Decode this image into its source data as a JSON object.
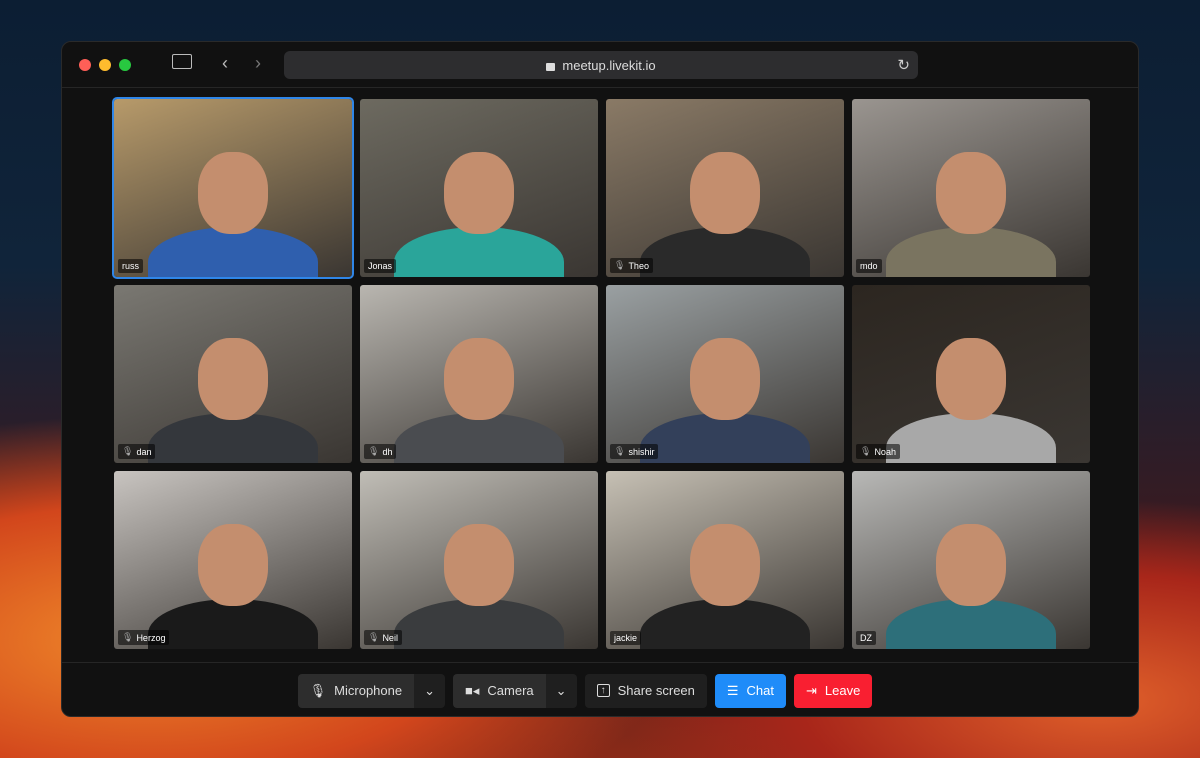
{
  "browser": {
    "url": "meetup.livekit.io",
    "traffic_lights": [
      "#fe5f57",
      "#febc2e",
      "#28c840"
    ]
  },
  "participants": [
    {
      "name": "russ",
      "muted": false,
      "active": true,
      "bg": "#b79a6a",
      "shirt": "#2f5fae"
    },
    {
      "name": "Jonas",
      "muted": false,
      "active": false,
      "bg": "#6d6a60",
      "shirt": "#2aa59a"
    },
    {
      "name": "Theo",
      "muted": true,
      "active": false,
      "bg": "#8a7a66",
      "shirt": "#2a2a2a"
    },
    {
      "name": "mdo",
      "muted": false,
      "active": false,
      "bg": "#9a9590",
      "shirt": "#7a7460"
    },
    {
      "name": "dan",
      "muted": true,
      "active": false,
      "bg": "#7a7872",
      "shirt": "#34373c"
    },
    {
      "name": "dh",
      "muted": true,
      "active": false,
      "bg": "#b9b6b0",
      "shirt": "#4a4c50"
    },
    {
      "name": "shishir",
      "muted": true,
      "active": false,
      "bg": "#9aa0a2",
      "shirt": "#33405a"
    },
    {
      "name": "Noah",
      "muted": true,
      "active": false,
      "bg": "#2c2620",
      "shirt": "#a8a8a8"
    },
    {
      "name": "Herzog",
      "muted": true,
      "active": false,
      "bg": "#c8c4c0",
      "shirt": "#1a1a1a"
    },
    {
      "name": "Neil",
      "muted": true,
      "active": false,
      "bg": "#c0bdb6",
      "shirt": "#3a3c3e"
    },
    {
      "name": "jackie",
      "muted": false,
      "active": false,
      "bg": "#c6c0b4",
      "shirt": "#222"
    },
    {
      "name": "DZ",
      "muted": false,
      "active": false,
      "bg": "#b8b8b6",
      "shirt": "#2d6f7a"
    }
  ],
  "controls": {
    "microphone": "Microphone",
    "camera": "Camera",
    "share": "Share screen",
    "chat": "Chat",
    "leave": "Leave",
    "chat_color": "#1f8cf9",
    "leave_color": "#f91f31"
  }
}
